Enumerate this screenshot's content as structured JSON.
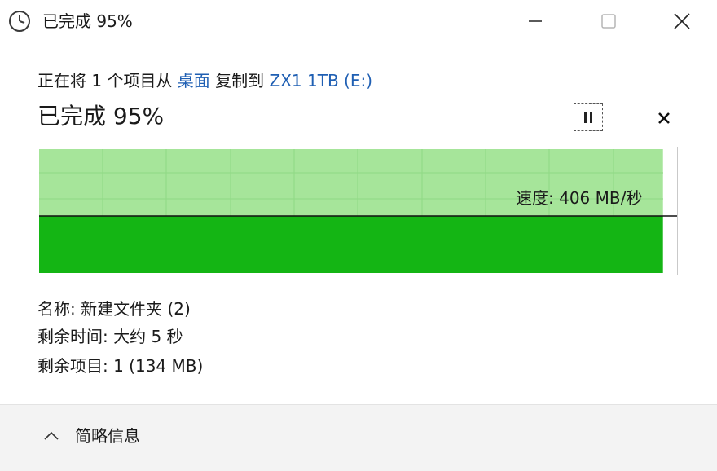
{
  "window": {
    "title": "已完成 95%",
    "icon": "clock-icon"
  },
  "status": {
    "prefix": "正在将 1 个项目从 ",
    "source": "桌面",
    "middle": " 复制到 ",
    "destination": "ZX1 1TB (E:)"
  },
  "progress": {
    "heading": "已完成 95%",
    "percent": 95,
    "speed_label": "速度: 406 MB/秒"
  },
  "details": {
    "name": "名称: 新建文件夹 (2)",
    "time_remaining": "剩余时间: 大约 5 秒",
    "items_remaining": "剩余项目: 1 (134 MB)"
  },
  "footer": {
    "toggle_label": "简略信息"
  },
  "colors": {
    "graph_fill_dark": "#14b514",
    "graph_fill_light": "#a6e59a",
    "graph_grid": "#8fd984",
    "link": "#1f5fb3",
    "footer_bg": "#f3f3f3"
  }
}
